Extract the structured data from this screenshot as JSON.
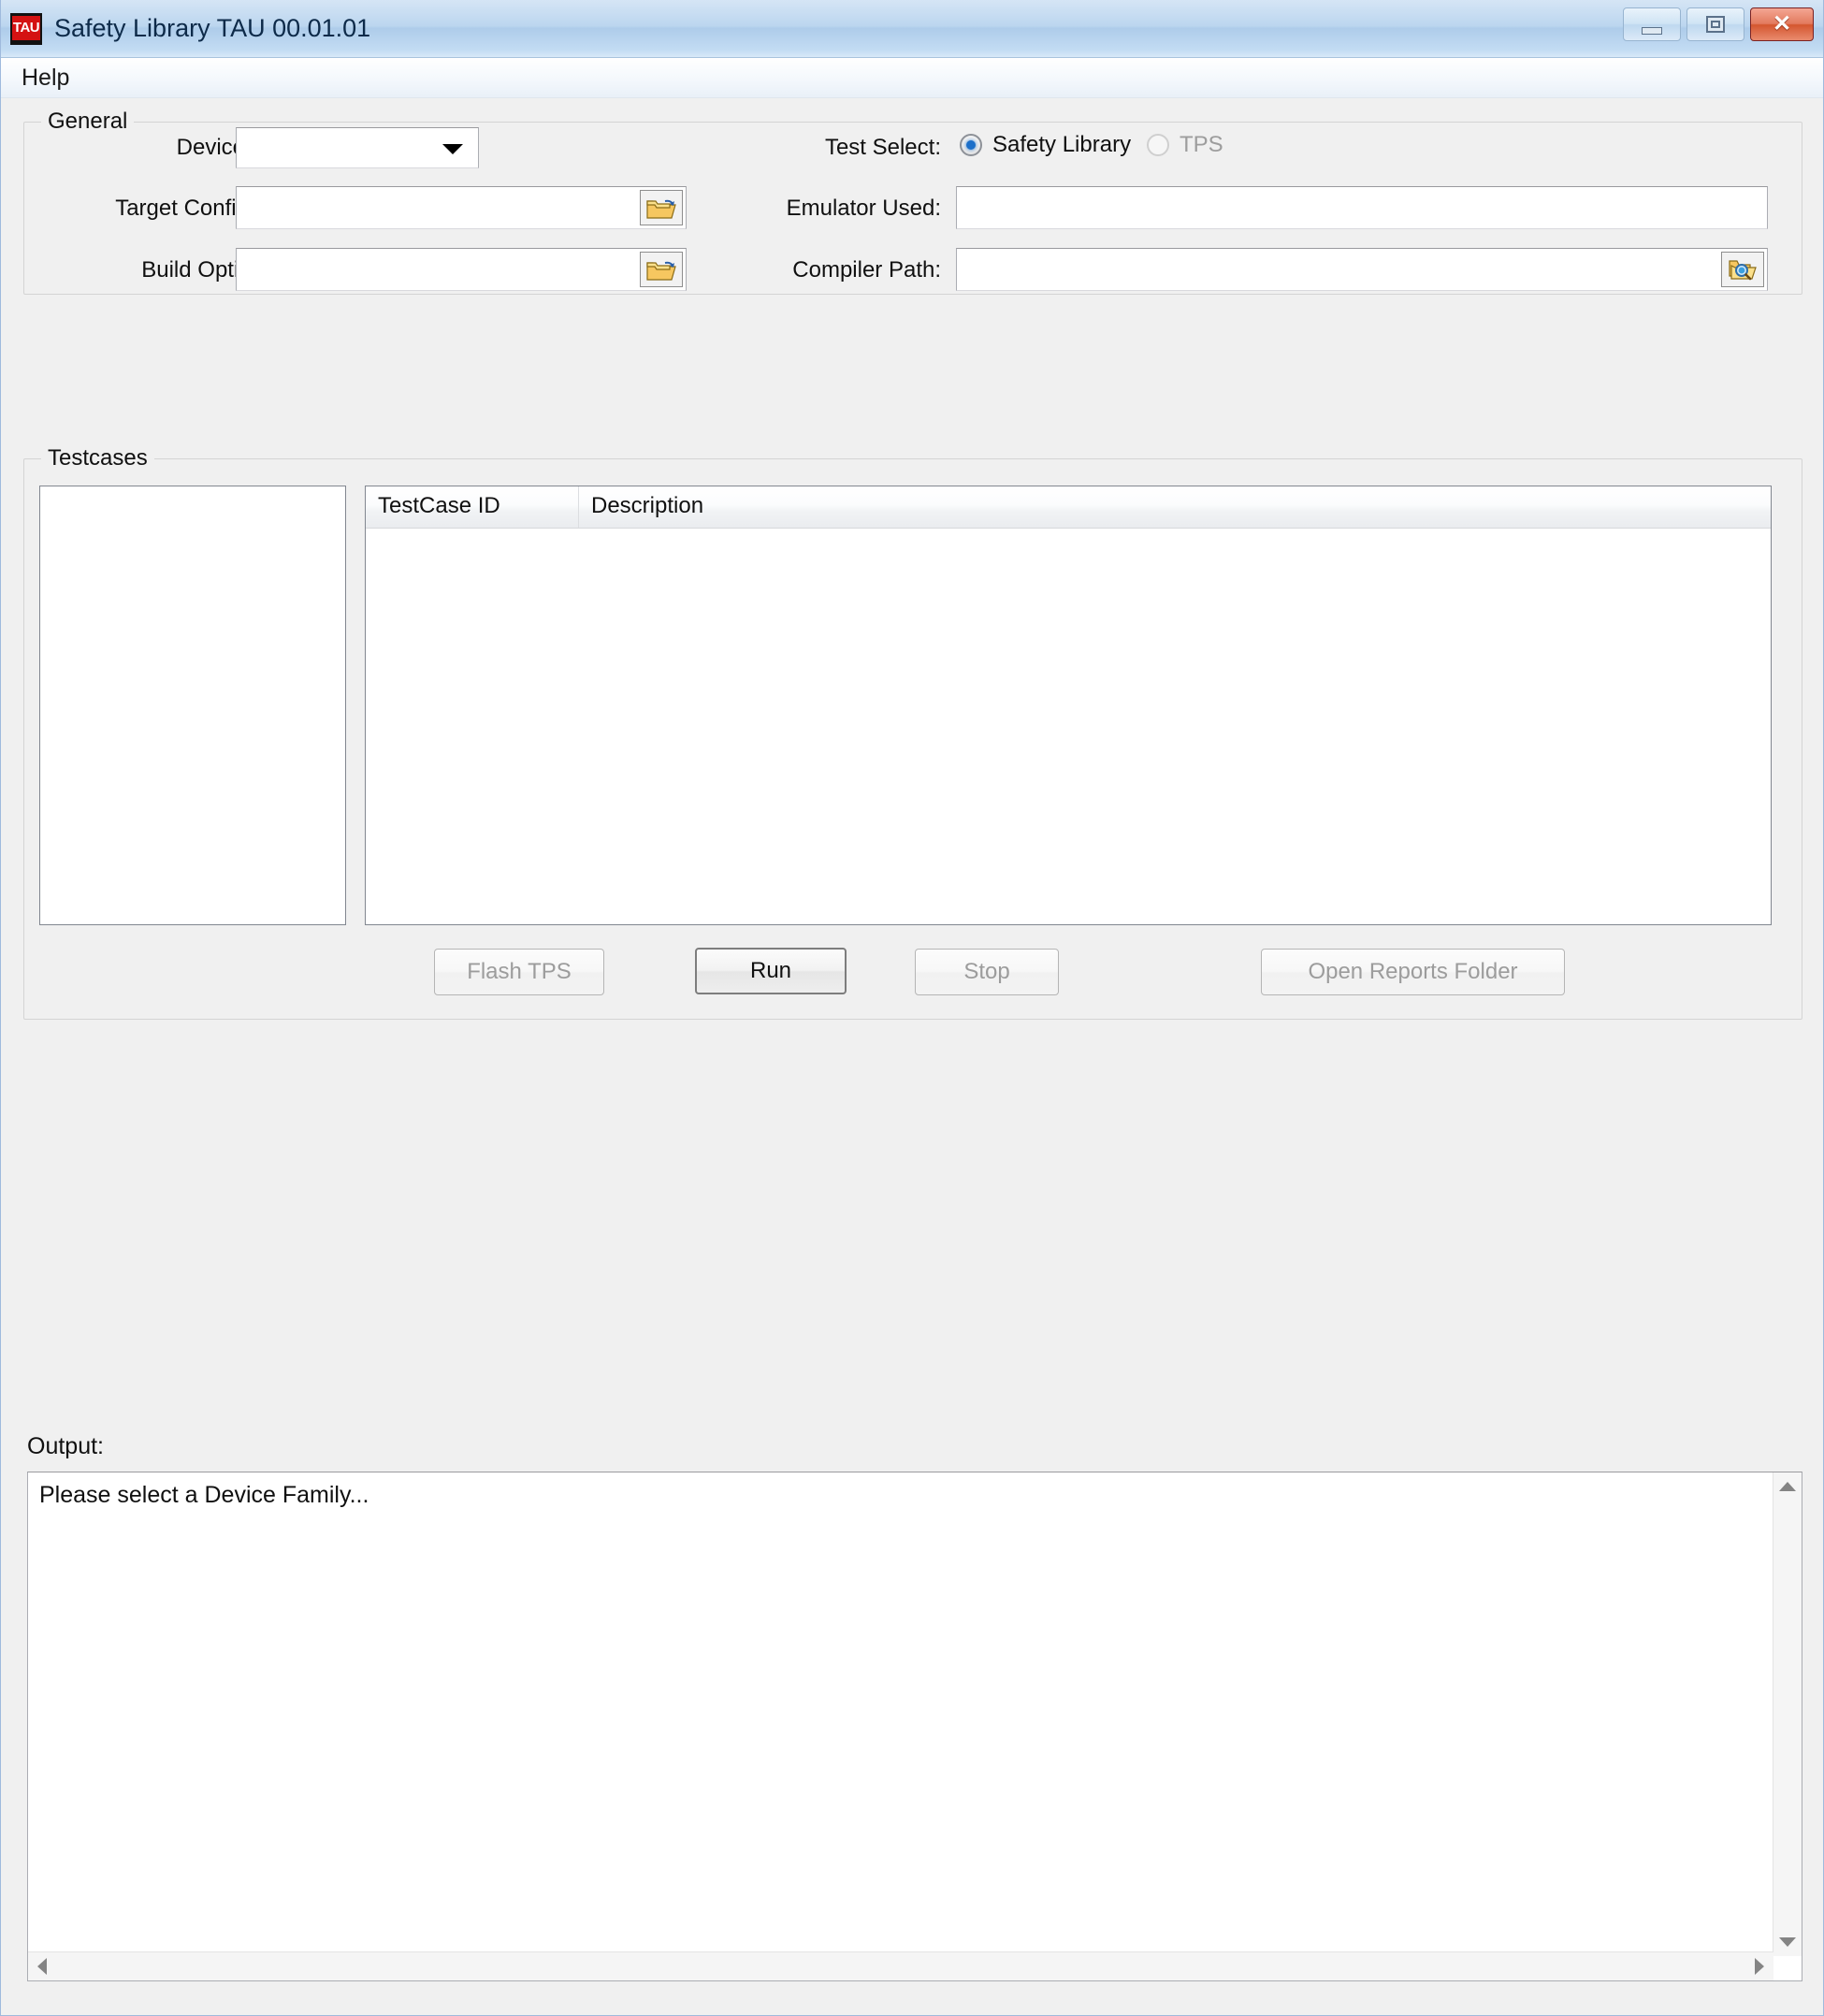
{
  "window": {
    "title": "Safety Library TAU 00.01.01",
    "icon_label": "TAU",
    "icon_name": "tau-app-icon",
    "controls": {
      "minimize": "minimize-icon",
      "maximize": "maximize-icon",
      "close": "close-icon",
      "close_glyph": "✕"
    }
  },
  "menubar": {
    "items": [
      {
        "label": "Help"
      }
    ]
  },
  "general": {
    "title": "General",
    "device_family": {
      "label": "Device Family:",
      "value": "",
      "placeholder": "",
      "icon": "chevron-down-icon"
    },
    "target_configuration": {
      "label": "Target Configuration:",
      "value": "",
      "placeholder": "",
      "browse_icon": "open-folder-icon"
    },
    "build_options_file": {
      "label": "Build Options File:",
      "value": "",
      "placeholder": "",
      "browse_icon": "open-folder-icon"
    },
    "test_select": {
      "label": "Test Select:",
      "options": [
        {
          "label": "Safety Library",
          "checked": true,
          "disabled": false
        },
        {
          "label": "TPS",
          "checked": false,
          "disabled": true
        }
      ]
    },
    "emulator_used": {
      "label": "Emulator Used:",
      "value": "",
      "placeholder": ""
    },
    "compiler_path": {
      "label": "Compiler Path:",
      "value": "",
      "placeholder": "",
      "browse_icon": "folder-search-icon"
    }
  },
  "testcases": {
    "title": "Testcases",
    "list_items": [],
    "columns": [
      {
        "label": "TestCase ID"
      },
      {
        "label": "Description"
      }
    ],
    "rows": []
  },
  "actions": {
    "flash_tps": {
      "label": "Flash TPS",
      "enabled": false
    },
    "run": {
      "label": "Run",
      "enabled": true
    },
    "stop": {
      "label": "Stop",
      "enabled": false
    },
    "open_reports_folder": {
      "label": "Open Reports Folder",
      "enabled": false
    }
  },
  "output": {
    "label": "Output:",
    "text": "Please select a Device Family...",
    "scroll_up_icon": "scroll-up-arrow-icon",
    "scroll_down_icon": "scroll-down-arrow-icon",
    "scroll_left_icon": "scroll-left-arrow-icon",
    "scroll_right_icon": "scroll-right-arrow-icon"
  },
  "colors": {
    "accent": "#1c6fc9",
    "close_button": "#d4562f",
    "app_icon": "#d41212",
    "window_background": "#f0f0f0"
  }
}
